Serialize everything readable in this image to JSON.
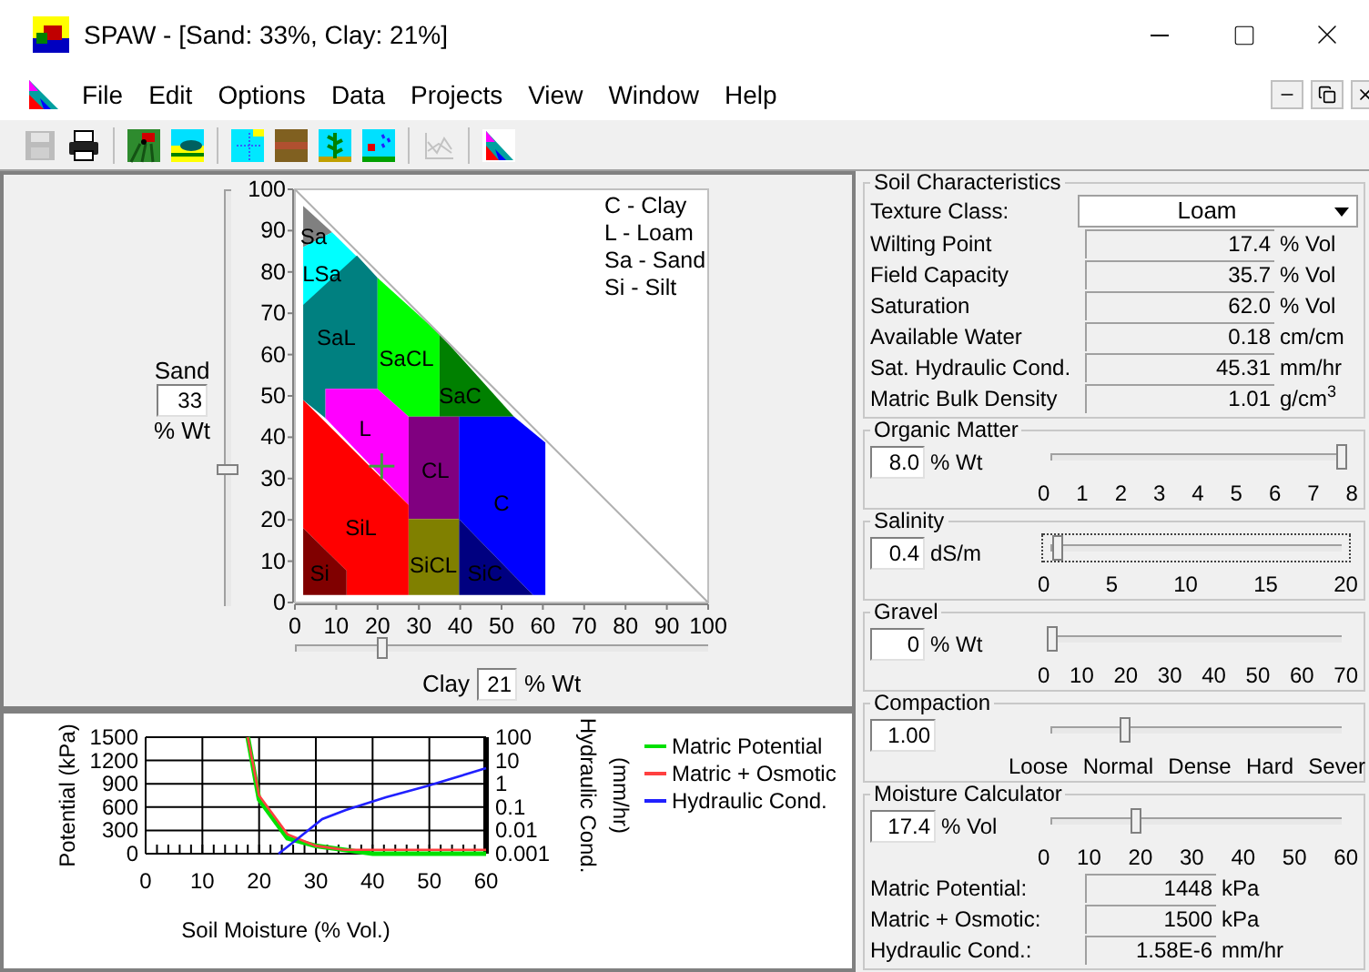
{
  "window": {
    "title": "SPAW - [Sand: 33%, Clay: 21%]"
  },
  "menu": [
    "File",
    "Edit",
    "Options",
    "Data",
    "Projects",
    "View",
    "Window",
    "Help"
  ],
  "toolbar": [
    [
      {
        "kind": "save",
        "disabled": true
      },
      {
        "kind": "print",
        "disabled": false
      }
    ],
    [
      {
        "kind": "field",
        "disabled": false
      },
      {
        "kind": "landscape",
        "disabled": false
      }
    ],
    [
      {
        "kind": "grid",
        "disabled": false
      },
      {
        "kind": "soil",
        "disabled": false
      },
      {
        "kind": "plant",
        "disabled": false
      },
      {
        "kind": "sprinkler",
        "disabled": false
      }
    ],
    [
      {
        "kind": "chart",
        "disabled": true
      }
    ],
    [
      {
        "kind": "triangle",
        "disabled": false
      }
    ]
  ],
  "triangle": {
    "sand": {
      "label": "Sand",
      "value": "33",
      "unit": "% Wt",
      "level": 0.33
    },
    "clay": {
      "label": "Clay",
      "value": "21",
      "unit": "% Wt",
      "level": 0.21
    },
    "sand_ticks": [
      "100",
      "90",
      "80",
      "70",
      "60",
      "50",
      "40",
      "30",
      "20",
      "10",
      "0"
    ],
    "clay_ticks": [
      "0",
      "10",
      "20",
      "30",
      "40",
      "50",
      "60",
      "70",
      "80",
      "90",
      "100"
    ],
    "legend": [
      "C - Clay",
      "L - Loam",
      "Sa - Sand",
      "Si - Silt"
    ],
    "regions": [
      {
        "label": "Sa",
        "color": "#808080"
      },
      {
        "label": "LSa",
        "color": "#00ffff"
      },
      {
        "label": "SaL",
        "color": "#008080"
      },
      {
        "label": "SaCL",
        "color": "#00ff00"
      },
      {
        "label": "SaC",
        "color": "#008000"
      },
      {
        "label": "L",
        "color": "#ff00ff"
      },
      {
        "label": "CL",
        "color": "#800080"
      },
      {
        "label": "C",
        "color": "#0000ff"
      },
      {
        "label": "SiC",
        "color": "#000080"
      },
      {
        "label": "SiCL",
        "color": "#808000"
      },
      {
        "label": "SiL",
        "color": "#ff0000"
      },
      {
        "label": "Si",
        "color": "#800000"
      }
    ]
  },
  "chart": {
    "y2_unit_label": "(mm/hr)",
    "y2_title": "Hydraulic Cond.",
    "conductivity_legend": {
      "name": "Hydraulic Cond.",
      "color": "#2020ff"
    },
    "right_axis_ticks": [
      "100",
      "10",
      "1",
      "0.1",
      "0.01",
      "0.001"
    ],
    "chart_data": {
      "type": "line",
      "xlabel": "Soil Moisture (% Vol.)",
      "ylabel": "Potential (kPa)",
      "x": [
        18,
        20,
        25,
        30,
        35,
        40,
        50,
        60
      ],
      "series": [
        {
          "name": "Matric Potential",
          "color": "#00e000",
          "values": [
            1500,
            700,
            200,
            100,
            50,
            0,
            0,
            0
          ]
        },
        {
          "name": "Matric + Osmotic",
          "color": "#ff4040",
          "values": [
            1500,
            750,
            250,
            100,
            50,
            50,
            50,
            50
          ]
        }
      ],
      "xlim": [
        0,
        60
      ],
      "ylim": [
        0,
        1500
      ],
      "grid": true,
      "xticks": [
        0,
        10,
        20,
        30,
        40,
        50,
        60
      ],
      "yticks": [
        0,
        300,
        600,
        900,
        1200,
        1500
      ]
    }
  },
  "soil_characteristics": {
    "title": "Soil Characteristics",
    "texture": {
      "label": "Texture Class:",
      "value": "Loam"
    },
    "rows": [
      {
        "label": "Wilting Point",
        "value": "17.4",
        "unit": "% Vol"
      },
      {
        "label": "Field Capacity",
        "value": "35.7",
        "unit": "% Vol"
      },
      {
        "label": "Saturation",
        "value": "62.0",
        "unit": "% Vol"
      },
      {
        "label": "Available Water",
        "value": "0.18",
        "unit": "cm/cm"
      },
      {
        "label": "Sat. Hydraulic Cond.",
        "value": "45.31",
        "unit": "mm/hr"
      },
      {
        "label": "Matric Bulk Density",
        "value": "1.01",
        "unit": "g/cm$^{3}$"
      }
    ]
  },
  "sliders": [
    {
      "title": "Organic Matter",
      "value": "8.0",
      "unit": "% Wt",
      "level": 1,
      "focused": false,
      "kind": "numbers",
      "ticks": [
        "0",
        "1",
        "2",
        "3",
        "4",
        "5",
        "6",
        "7",
        "8"
      ]
    },
    {
      "title": "Salinity",
      "value": "0.4",
      "unit": "dS/m",
      "level": 0.02,
      "focused": true,
      "kind": "numbers",
      "ticks": [
        "0",
        "5",
        "10",
        "15",
        "20"
      ]
    },
    {
      "title": "Gravel",
      "value": "0",
      "unit": "% Wt",
      "level": 0,
      "focused": false,
      "kind": "numbers",
      "ticks": [
        "0",
        "10",
        "20",
        "30",
        "40",
        "50",
        "60",
        "70"
      ]
    },
    {
      "title": "Compaction",
      "value": "1.00",
      "level": 0.25,
      "focused": false,
      "kind": "words",
      "ticks": [
        "Loose",
        "Normal",
        "Dense",
        "Hard",
        "Sever"
      ]
    }
  ],
  "moisture": {
    "title": "Moisture Calculator",
    "value": "17.4",
    "unit": "% Vol",
    "level": 0.29,
    "focused": false,
    "ticks": [
      "0",
      "10",
      "20",
      "30",
      "40",
      "50",
      "60"
    ],
    "results": [
      {
        "label": "Matric Potential:",
        "value": "1448",
        "unit": "kPa"
      },
      {
        "label": "Matric + Osmotic:",
        "value": "1500",
        "unit": "kPa"
      },
      {
        "label": "Hydraulic Cond.:",
        "value": "1.58E-6",
        "unit": "mm/hr"
      }
    ]
  }
}
